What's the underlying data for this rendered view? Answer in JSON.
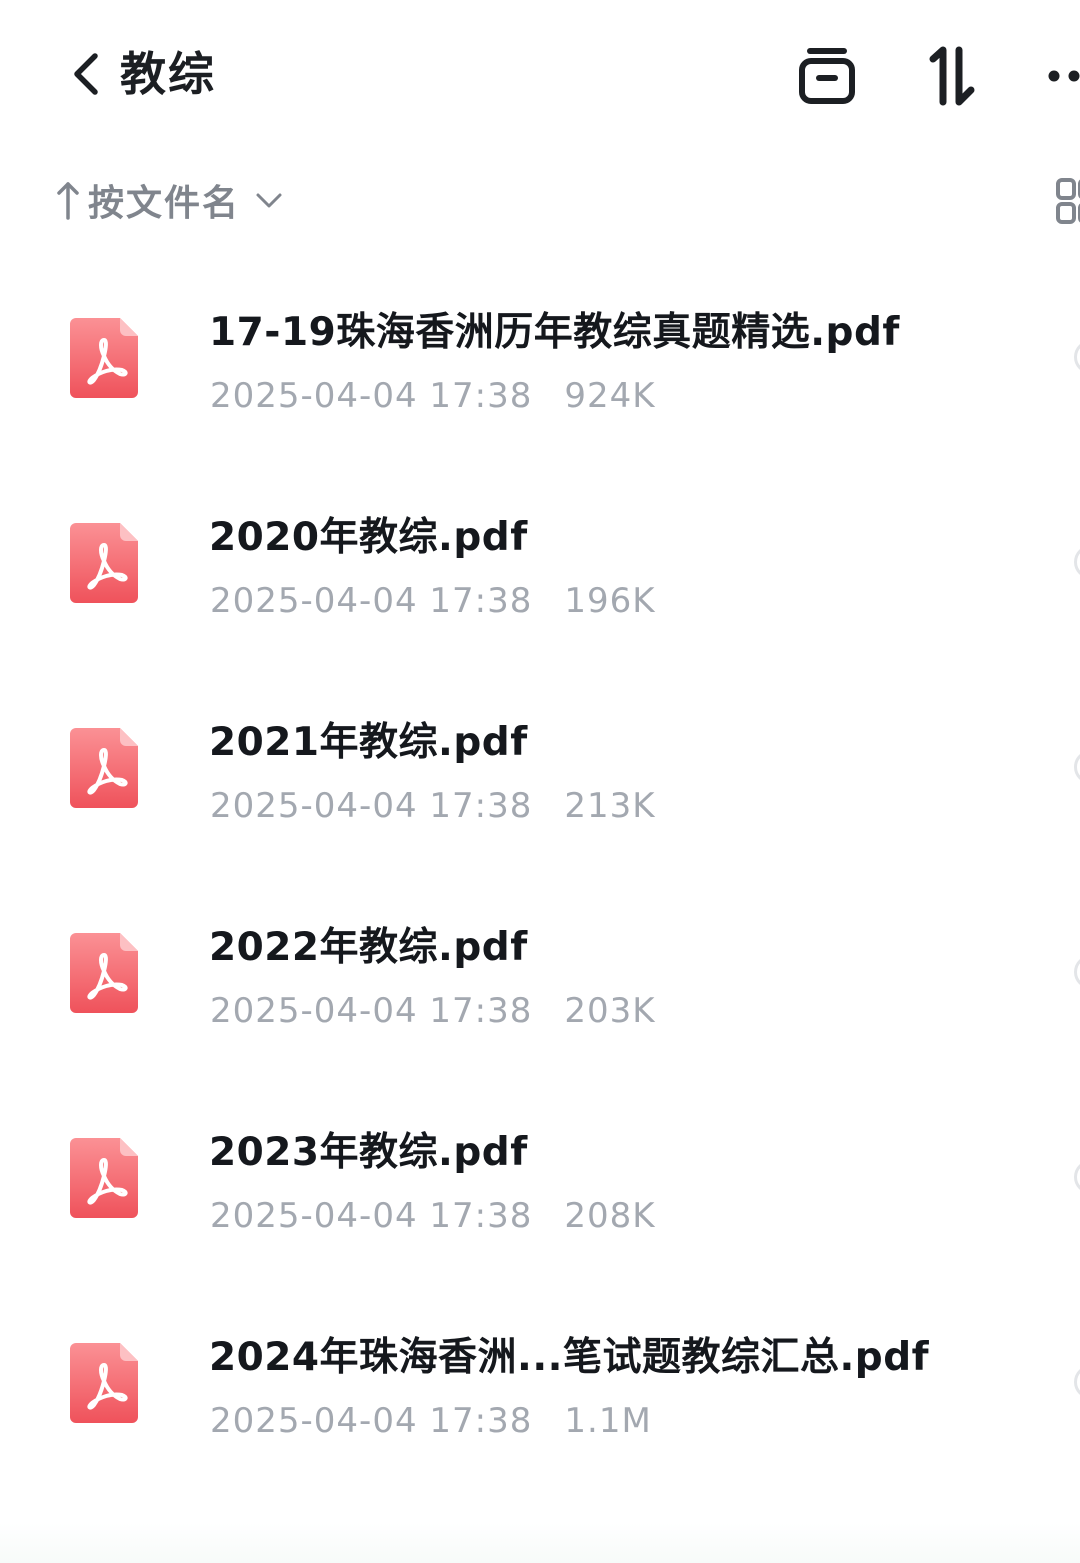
{
  "header": {
    "title": "教综",
    "back_icon": "chevron-left-icon",
    "actions": [
      "archive-box-icon",
      "sort-arrows-icon",
      "more-dots-icon"
    ]
  },
  "sort": {
    "label": "按文件名",
    "direction_icon": "arrow-up-icon",
    "dropdown_icon": "chevron-down-icon",
    "view_toggle_icon": "grid-view-icon"
  },
  "files": [
    {
      "name": "17-19珠海香洲历年教综真题精选.pdf",
      "date": "2025-04-04 17:38",
      "size": "924K",
      "icon": "pdf-file-icon"
    },
    {
      "name": "2020年教综.pdf",
      "date": "2025-04-04 17:38",
      "size": "196K",
      "icon": "pdf-file-icon"
    },
    {
      "name": "2021年教综.pdf",
      "date": "2025-04-04 17:38",
      "size": "213K",
      "icon": "pdf-file-icon"
    },
    {
      "name": "2022年教综.pdf",
      "date": "2025-04-04 17:38",
      "size": "203K",
      "icon": "pdf-file-icon"
    },
    {
      "name": "2023年教综.pdf",
      "date": "2025-04-04 17:38",
      "size": "208K",
      "icon": "pdf-file-icon"
    },
    {
      "name": "2024年珠海香洲...笔试题教综汇总.pdf",
      "date": "2025-04-04 17:38",
      "size": "1.1M",
      "icon": "pdf-file-icon"
    }
  ],
  "colors": {
    "pdf_icon_top": "#f98b8f",
    "pdf_icon_bottom": "#f0555d",
    "title_text": "#15181d",
    "meta_text": "#a3a8b0",
    "sort_text": "#80858d"
  }
}
